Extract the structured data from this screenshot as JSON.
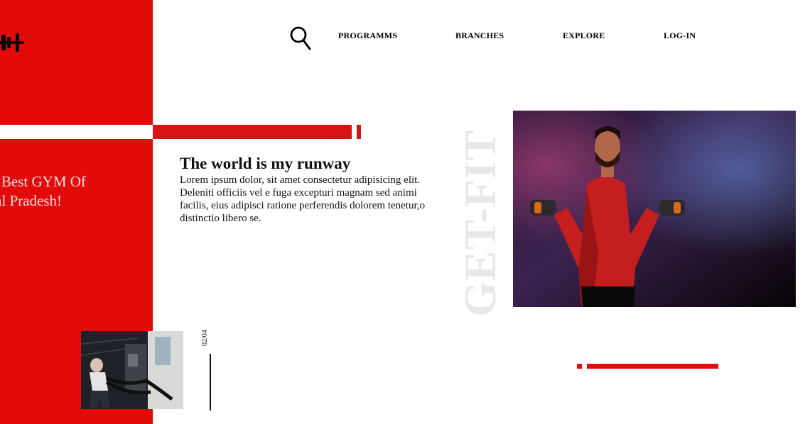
{
  "nav": {
    "items": [
      "PROGRAMMS",
      "BRANCHES",
      "EXPLORE",
      "LOG-IN"
    ]
  },
  "sidebar": {
    "tagline_line1": "The Best GYM Of",
    "tagline_line2": "achal Pradesh!"
  },
  "hero": {
    "headline": "The world is my runway",
    "body": "Lorem ipsum dolor, sit amet consectetur adipisicing elit. Deleniti officiis vel e fuga excepturi magnam sed animi facilis, eius adipisci ratione perferendis dolorem tenetur,o distinctio libero se.",
    "brand_vertical": "GET-FIT"
  },
  "slider": {
    "counter": "02/04"
  },
  "colors": {
    "brand_red": "#e30a0a",
    "bar_red": "#d71414",
    "watermark_gray": "#e8e8e8"
  },
  "icons": {
    "logo": "dumbbell-icon",
    "search": "search-icon"
  }
}
